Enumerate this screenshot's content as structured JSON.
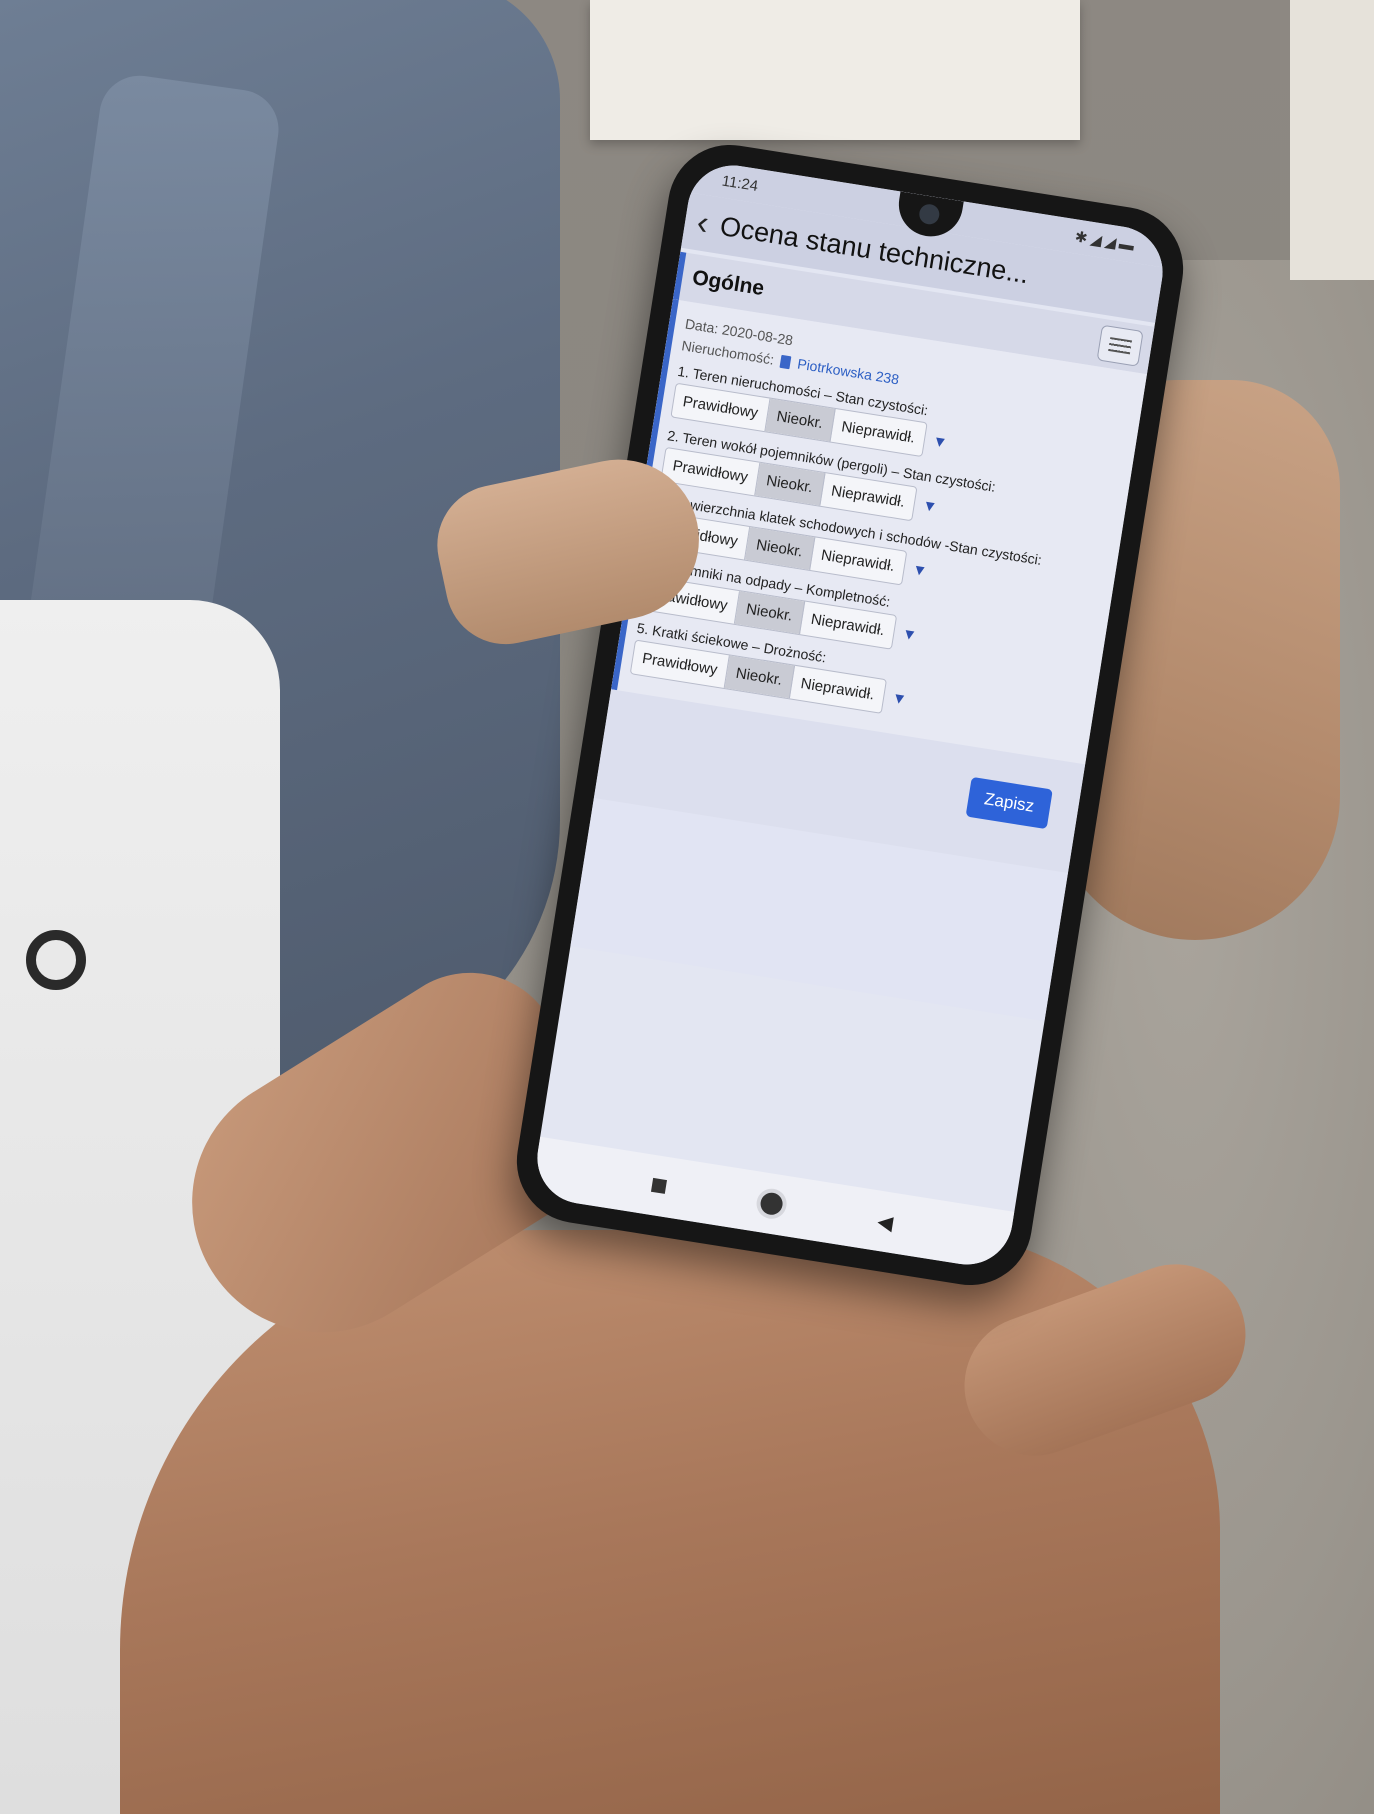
{
  "status_bar": {
    "time": "11:24",
    "icons": "✱◢◢▬"
  },
  "app_bar": {
    "title": "Ocena stanu techniczne..."
  },
  "section": {
    "title": "Ogólne"
  },
  "meta": {
    "date_label": "Data:",
    "date_value": "2020-08-28",
    "property_label": "Nieruchomość:",
    "property_value": "Piotrkowska 238"
  },
  "questions": [
    {
      "label": "1. Teren nieruchomości – Stan czystości:"
    },
    {
      "label": "2. Teren wokół pojemników (pergoli) – Stan czystości:"
    },
    {
      "label": "3. Nawierzchnia klatek schodowych i schodów -Stan czystości:"
    },
    {
      "label": "4. Pojemniki na odpady – Kompletność:"
    },
    {
      "label": "5. Kratki ściekowe – Drożność:"
    }
  ],
  "options": {
    "ok": "Prawidłowy",
    "unknown": "Nieokr.",
    "bad": "Nieprawidł."
  },
  "selected_option": "unknown",
  "caret": "▼",
  "save_label": "Zapisz",
  "nav": {
    "back": "◀"
  },
  "colors": {
    "accent": "#2e63d9",
    "selected": "#c9cbd4",
    "section_bar": "#3a66c8"
  }
}
